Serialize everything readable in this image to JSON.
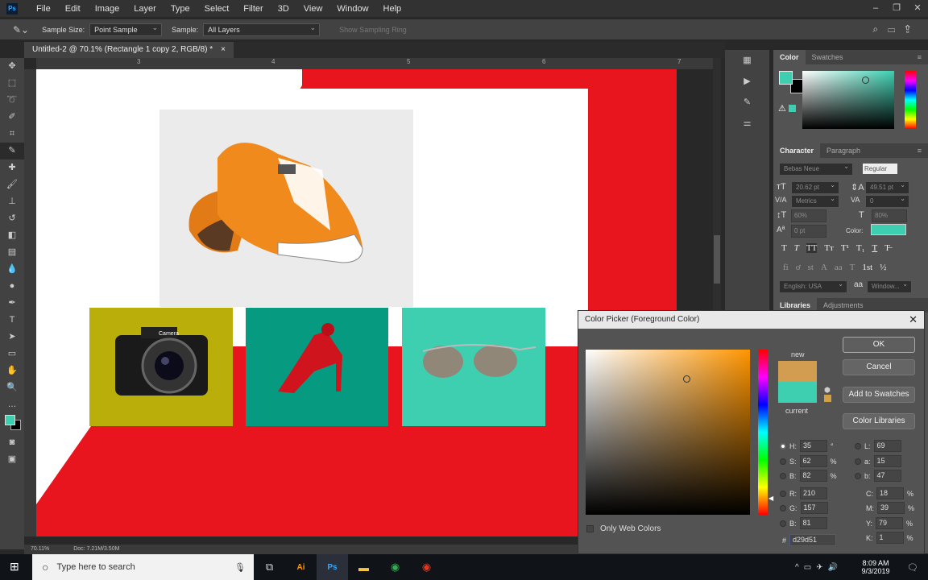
{
  "app": {
    "logo": "Ps"
  },
  "menu": [
    "File",
    "Edit",
    "Image",
    "Layer",
    "Type",
    "Select",
    "Filter",
    "3D",
    "View",
    "Window",
    "Help"
  ],
  "options": {
    "sample_size_label": "Sample Size:",
    "sample_size": "Point Sample",
    "sample_label": "Sample:",
    "sample": "All Layers",
    "sampling_ring": "Show Sampling Ring"
  },
  "document": {
    "tab_title": "Untitled-2 @ 70.1% (Rectangle 1 copy 2, RGB/8) *",
    "close": "×",
    "ruler_marks": [
      "3",
      "4",
      "5",
      "6",
      "7"
    ],
    "zoom": "70.11%",
    "doc_info": "Doc: 7.21M/3.50M"
  },
  "canvas": {
    "camera_label": "Camera",
    "colors": {
      "red": "#e8141e",
      "olive": "#b9ae0a",
      "teal": "#069a80",
      "aqua": "#3ecfb1",
      "white": "#ffffff",
      "gray": "#ebebeb"
    }
  },
  "color_panel": {
    "tabs": [
      "Color",
      "Swatches"
    ],
    "foreground": "#3ecfb1",
    "background": "#000000"
  },
  "character_panel": {
    "tabs": [
      "Character",
      "Paragraph"
    ],
    "font": "Bebas Neue",
    "style": "Regular",
    "size": "20.62 pt",
    "leading": "49.51 pt",
    "kerning": "Metrics",
    "tracking": "0",
    "vscale": "60%",
    "hscale": "80%",
    "baseline": "0 pt",
    "color_label": "Color:",
    "color": "#3ecfb1",
    "type_buttons": [
      "T",
      "T",
      "TT",
      "Tт",
      "T¹",
      "T₁",
      "T",
      "T̶"
    ],
    "opentype_buttons": [
      "fi",
      "ơ",
      "st",
      "A",
      "aa",
      "T",
      "1st",
      "½"
    ],
    "language": "English: USA",
    "aa_label": "aa",
    "aa_method": "Window..."
  },
  "bottom_tabs": [
    "Libraries",
    "Adjustments"
  ],
  "color_picker": {
    "title": "Color Picker (Foreground Color)",
    "new_label": "new",
    "current_label": "current",
    "new_color": "#d29d51",
    "current_color": "#3ecfb1",
    "buttons": {
      "ok": "OK",
      "cancel": "Cancel",
      "add": "Add to Swatches",
      "libraries": "Color Libraries"
    },
    "only_web": "Only Web Colors",
    "hsb": [
      {
        "k": "H:",
        "v": "35",
        "u": "°",
        "selected": true
      },
      {
        "k": "S:",
        "v": "62",
        "u": "%"
      },
      {
        "k": "B:",
        "v": "82",
        "u": "%"
      }
    ],
    "lab": [
      {
        "k": "L:",
        "v": "69"
      },
      {
        "k": "a:",
        "v": "15"
      },
      {
        "k": "b:",
        "v": "47"
      }
    ],
    "rgb": [
      {
        "k": "R:",
        "v": "210"
      },
      {
        "k": "G:",
        "v": "157"
      },
      {
        "k": "B:",
        "v": "81"
      }
    ],
    "cmyk": [
      {
        "k": "C:",
        "v": "18",
        "u": "%"
      },
      {
        "k": "M:",
        "v": "39",
        "u": "%"
      },
      {
        "k": "Y:",
        "v": "79",
        "u": "%"
      },
      {
        "k": "K:",
        "v": "1",
        "u": "%"
      }
    ],
    "hex_label": "#",
    "hex": "d29d51"
  },
  "taskbar": {
    "search_placeholder": "Type here to search",
    "time": "8:09 AM",
    "date": "9/3/2019"
  }
}
